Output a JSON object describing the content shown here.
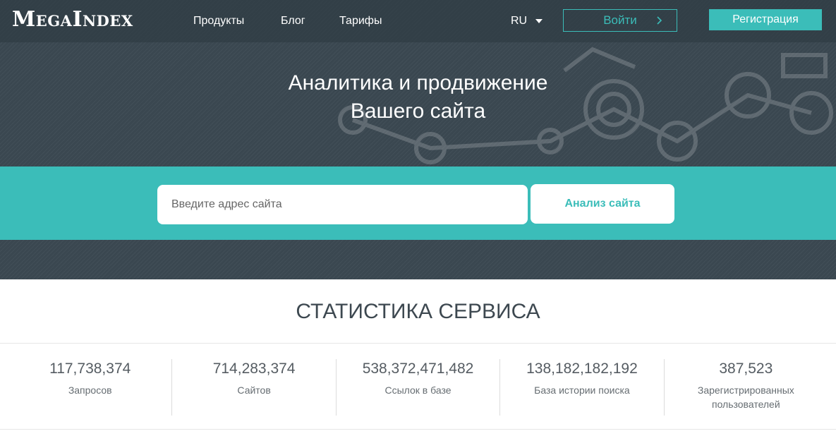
{
  "header": {
    "logo": "MegaIndex",
    "nav": [
      {
        "label": "Продукты"
      },
      {
        "label": "Блог"
      },
      {
        "label": "Тарифы"
      }
    ],
    "language": "RU",
    "login_label": "Войти",
    "signup_label": "Регистрация"
  },
  "hero": {
    "headline_line1": "Аналитика и продвижение",
    "headline_line2": "Вашего сайта"
  },
  "search": {
    "placeholder": "Введите адрес сайта",
    "button_label": "Анализ сайта"
  },
  "stats": {
    "title": "СТАТИСТИКА СЕРВИСА",
    "items": [
      {
        "value": "117,738,374",
        "label": "Запросов"
      },
      {
        "value": "714,283,374",
        "label": "Сайтов"
      },
      {
        "value": "538,372,471,482",
        "label": "Ссылок в базе"
      },
      {
        "value": "138,182,182,192",
        "label": "База истории поиска"
      },
      {
        "value": "387,523",
        "label": "Зарегистрированных пользователей"
      }
    ]
  },
  "colors": {
    "accent": "#3bbdb9",
    "hero_bg": "#3a4750",
    "text_dark": "#3d4850"
  }
}
